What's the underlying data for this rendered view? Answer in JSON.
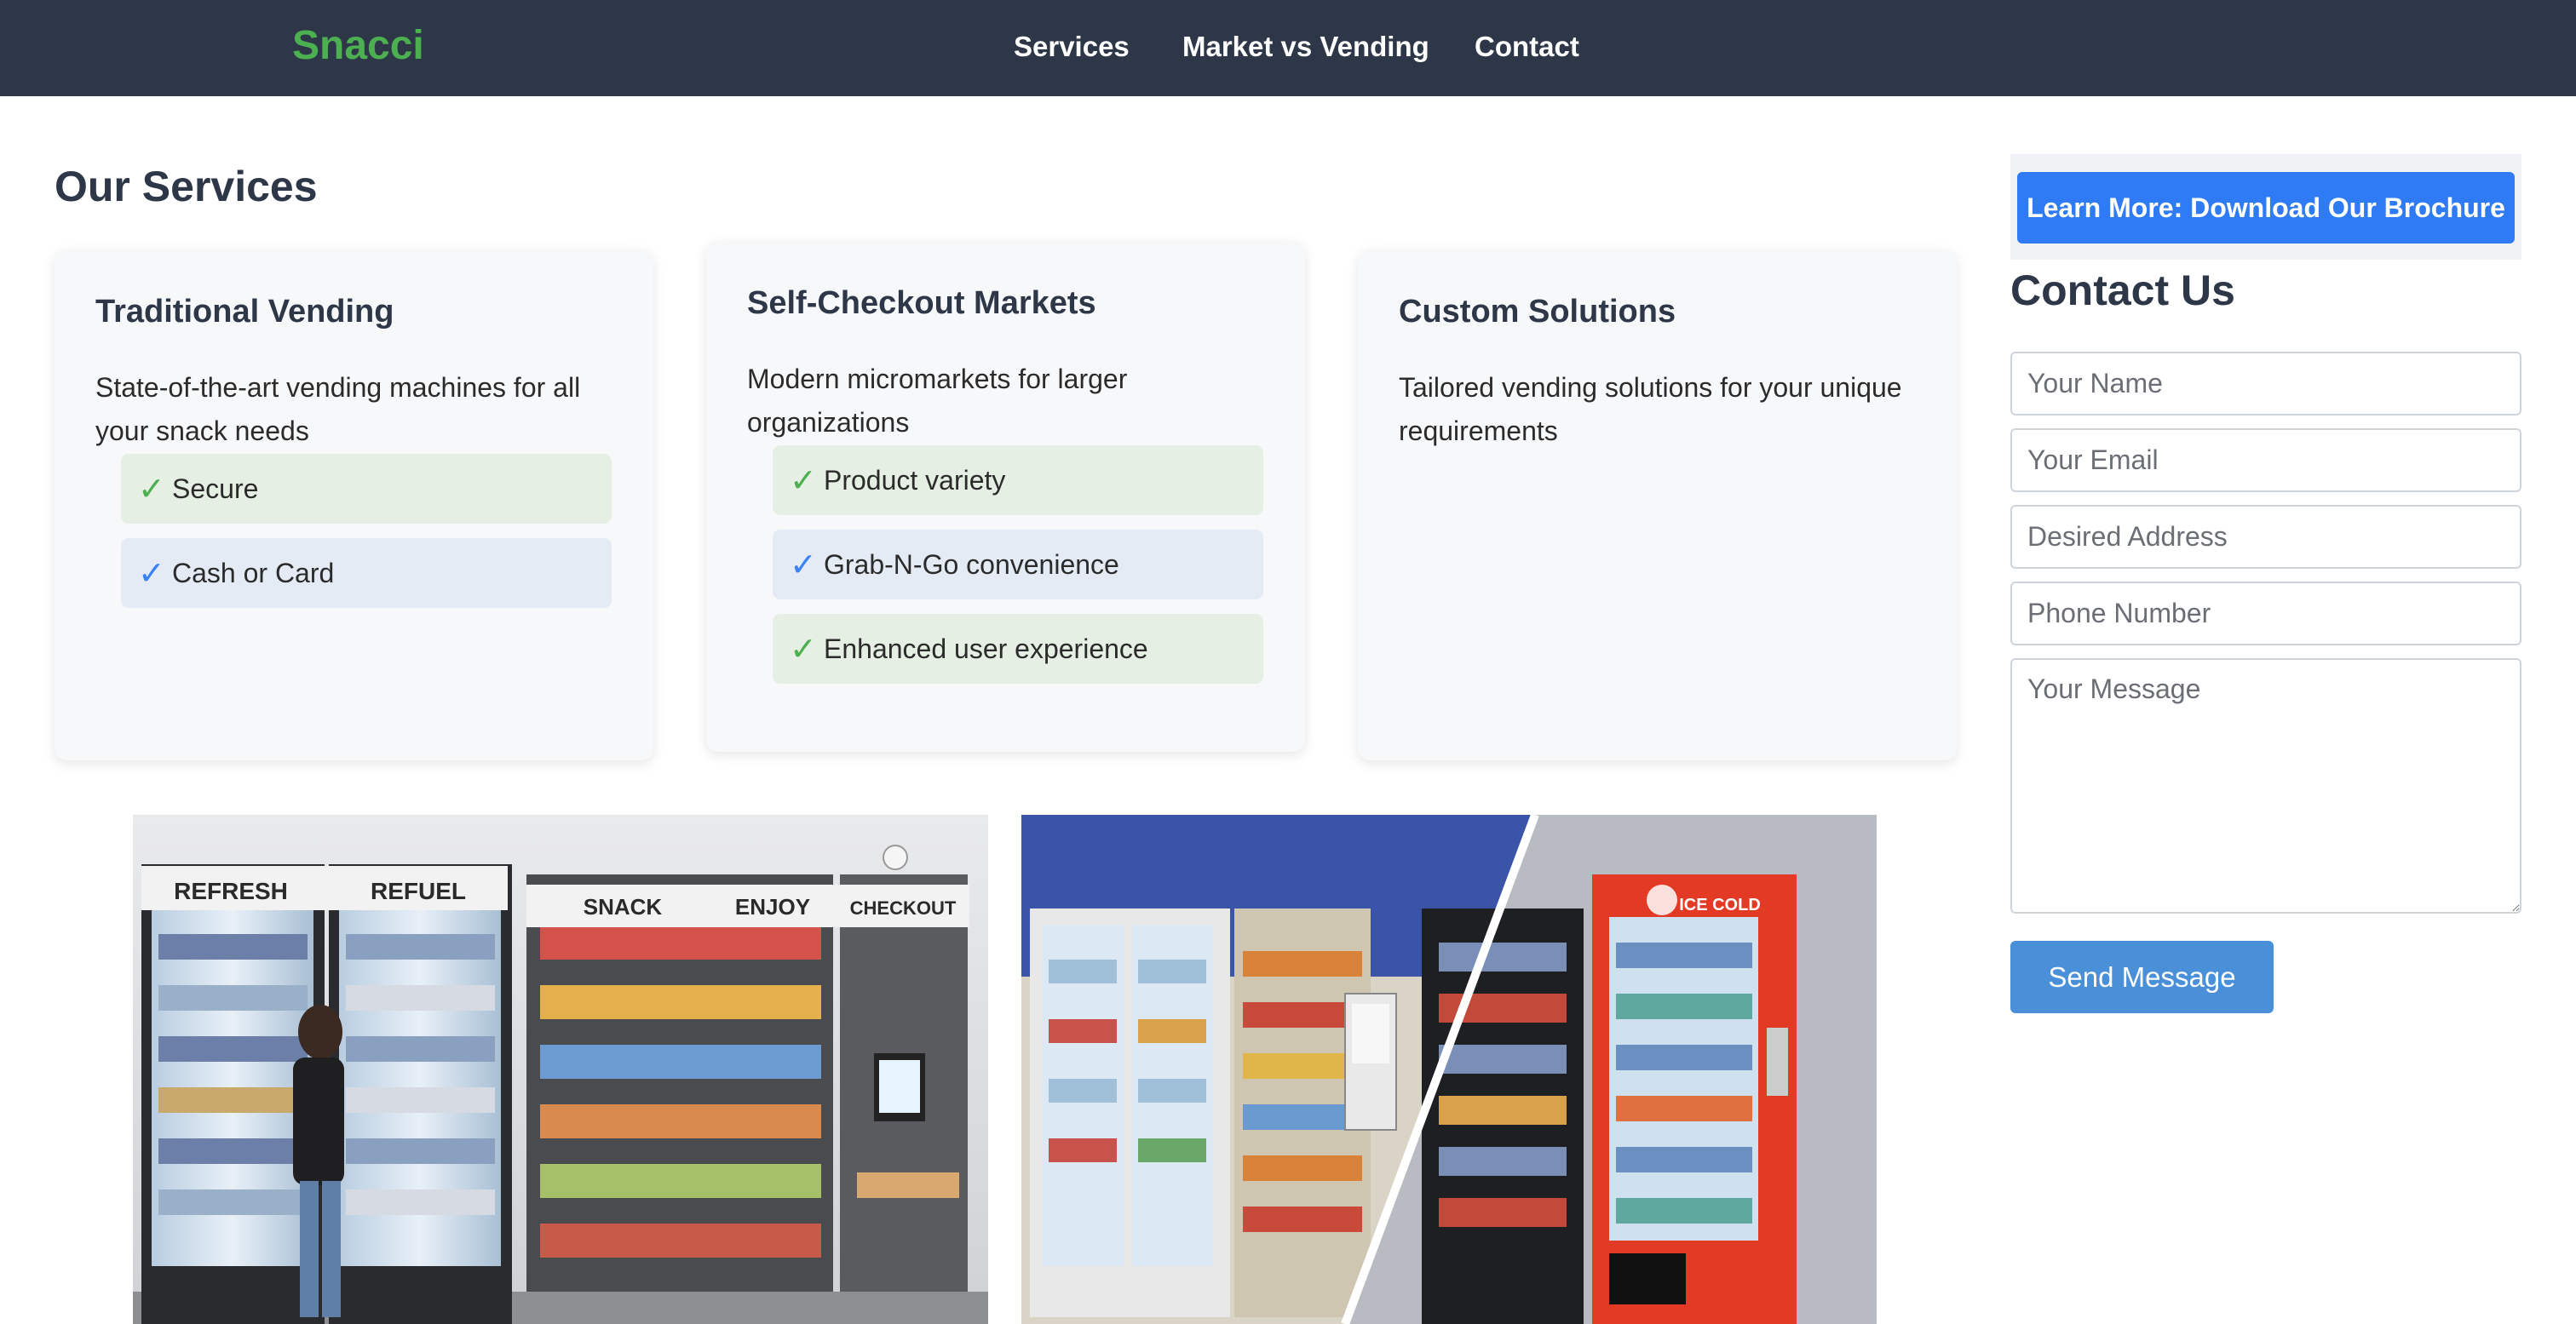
{
  "nav": {
    "brand": "Snacci",
    "links": [
      "Services",
      "Market vs Vending",
      "Contact"
    ]
  },
  "services": {
    "title": "Our Services",
    "cards": [
      {
        "title": "Traditional Vending",
        "desc": "State-of-the-art vending machines for all your snack needs",
        "features": [
          "Secure",
          "Cash or Card"
        ]
      },
      {
        "title": "Self-Checkout Markets",
        "desc": "Modern micromarkets for larger organizations",
        "features": [
          "Product variety",
          "Grab-N-Go convenience",
          "Enhanced user experience"
        ]
      },
      {
        "title": "Custom Solutions",
        "desc": "Tailored vending solutions for your unique requirements",
        "features": []
      }
    ],
    "images": [
      {
        "signs": [
          "REFRESH",
          "REFUEL",
          "SNACK",
          "ENJOY",
          "CHECKOUT"
        ]
      },
      {
        "signs": [
          "ICE COLD"
        ]
      }
    ]
  },
  "sidebar": {
    "brochure_label": "Learn More: Download Our Brochure",
    "contact_title": "Contact Us",
    "placeholders": {
      "name": "Your Name",
      "email": "Your Email",
      "address": "Desired Address",
      "phone": "Phone Number",
      "message": "Your Message"
    },
    "send_label": "Send Message"
  },
  "colors": {
    "nav_bg": "#2d3748",
    "brand": "#4caf50",
    "primary_button": "#2f7bf6",
    "send_button": "#4a90d9",
    "feature_green": "#e6efe3",
    "feature_blue": "#e4ebf5"
  }
}
